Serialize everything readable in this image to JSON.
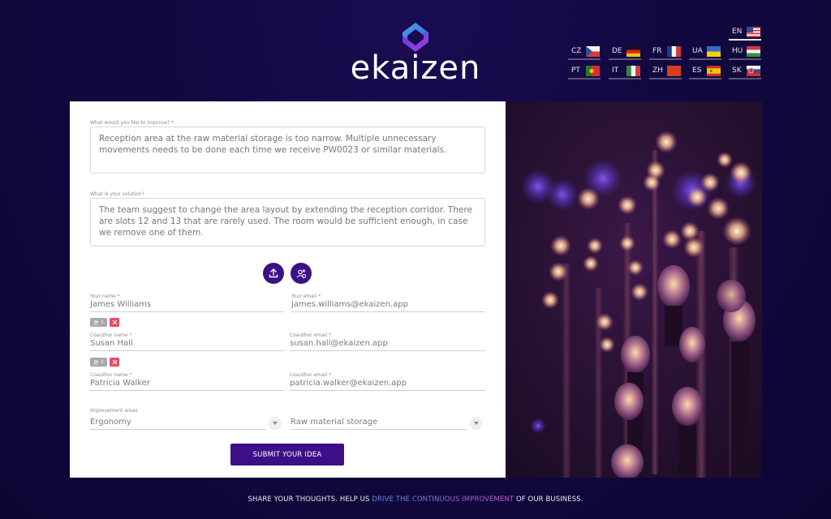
{
  "brand": {
    "name": "ekaizen",
    "logo_icon": "ekaizen-cube-logo"
  },
  "languages": {
    "active": "EN",
    "items": [
      {
        "code": "EN",
        "flag": "us-flag"
      },
      {
        "code": "CZ",
        "flag": "czech-flag"
      },
      {
        "code": "DE",
        "flag": "germany-flag"
      },
      {
        "code": "FR",
        "flag": "france-flag"
      },
      {
        "code": "UA",
        "flag": "ukraine-flag"
      },
      {
        "code": "HU",
        "flag": "hungary-flag"
      },
      {
        "code": "PT",
        "flag": "portugal-flag"
      },
      {
        "code": "IT",
        "flag": "italy-flag"
      },
      {
        "code": "ZH",
        "flag": "china-flag"
      },
      {
        "code": "ES",
        "flag": "spain-flag"
      },
      {
        "code": "SK",
        "flag": "slovakia-flag"
      }
    ]
  },
  "form": {
    "improve": {
      "label": "What would you like to improve? *",
      "value": "Reception area at the raw material storage is too narrow. Multiple unnecessary movements needs to be done each time we receive PW0023 or similar materials."
    },
    "solution": {
      "label": "What is your solution?",
      "value": "The team suggest to change the area layout by extending the reception corridor. There are slots 12 and 13 that are rarely used. The room would be sufficient enough, in case we remove one of them."
    },
    "actions": {
      "upload_icon": "upload-icon",
      "add_coauthor_icon": "add-coauthor-icon"
    },
    "author": {
      "name_label": "Your name *",
      "name_value": "James Williams",
      "email_label": "Your email *",
      "email_value": "james.williams@ekaizen.app"
    },
    "coauthors": [
      {
        "badge": "1",
        "name_label": "Coauthor name *",
        "name_value": "Susan Hall",
        "email_label": "Coauthor email *",
        "email_value": "susan.hall@ekaizen.app"
      },
      {
        "badge": "2",
        "name_label": "Coauthor name *",
        "name_value": "Patricia Walker",
        "email_label": "Coauthor email *",
        "email_value": "patricia.walker@ekaizen.app"
      }
    ],
    "areas": {
      "label": "Improvement areas",
      "primary": "Ergonomy",
      "secondary": "Raw material storage"
    },
    "submit_label": "SUBMIT YOUR IDEA"
  },
  "hero_image": {
    "description": "Purple-lit vintage Edison light bulbs with bokeh"
  },
  "footer": {
    "before": "SHARE YOUR THOUGHTS. HELP US ",
    "highlight": "DRIVE THE CONTINUOUS IMPROVEMENT",
    "after": " OF OUR BUSINESS."
  },
  "colors": {
    "brand_purple": "#3d0f87",
    "danger": "#e84a5f",
    "background": "#120840"
  }
}
